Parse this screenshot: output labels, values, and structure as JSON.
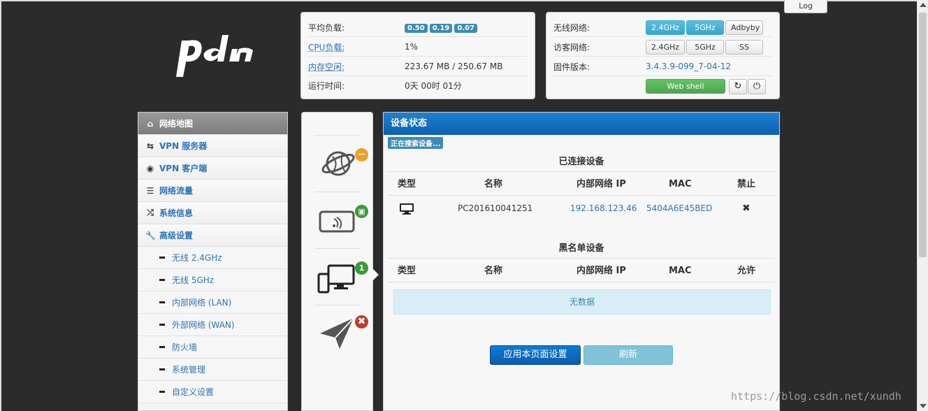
{
  "topbar": {
    "log_label": "Log"
  },
  "logo": {
    "text": "pdcn"
  },
  "system_stats": {
    "load_label": "平均负载:",
    "load_values": [
      "0.50",
      "0.19",
      "0.07"
    ],
    "cpu_label": "CPU负载:",
    "cpu_value": "1%",
    "mem_label": "内存空闲:",
    "mem_value": "223.67 MB / 250.67 MB",
    "uptime_label": "运行时间:",
    "uptime_value": "0天 00时 01分"
  },
  "network_info": {
    "wireless_label": "无线网络:",
    "wireless_buttons": [
      "2.4GHz",
      "5GHz",
      "Adbyby"
    ],
    "guest_label": "访客网络:",
    "guest_buttons": [
      "2.4GHz",
      "5GHz",
      "SS"
    ],
    "firmware_label": "固件版本:",
    "firmware_value": "3.4.3.9-099_7-04-12",
    "webshell_label": "Web shell"
  },
  "sidebar": {
    "items": [
      {
        "label": "网络地图",
        "icon": "home-icon",
        "active": true
      },
      {
        "label": "VPN 服务器",
        "icon": "retweet-icon"
      },
      {
        "label": "VPN 客户端",
        "icon": "globe-icon"
      },
      {
        "label": "网络流量",
        "icon": "list-icon"
      },
      {
        "label": "系统信息",
        "icon": "random-icon"
      },
      {
        "label": "高级设置",
        "icon": "wrench-icon"
      }
    ],
    "subitems": [
      "无线 2.4GHz",
      "无线 5GHz",
      "内部网络 (LAN)",
      "外部网络 (WAN)",
      "防火墙",
      "系统管理",
      "自定义设置"
    ]
  },
  "device_icons": {
    "badges": [
      "1"
    ]
  },
  "main": {
    "title": "设备状态",
    "searching_label": "正在搜索设备...",
    "connected_title": "已连接设备",
    "connected_headers": [
      "类型",
      "名称",
      "内部网络 IP",
      "MAC",
      "禁止"
    ],
    "connected_rows": [
      {
        "name": "PC201610041251",
        "ip": "192.168.123.46",
        "mac": "5404A6E45BED"
      }
    ],
    "blacklist_title": "黑名单设备",
    "blacklist_headers": [
      "类型",
      "名称",
      "内部网络 IP",
      "MAC",
      "允许"
    ],
    "no_data": "无数据",
    "apply_label": "应用本页面设置",
    "refresh_label": "刷新"
  },
  "watermark": "https://blog.csdn.net/xundh",
  "colors": {
    "background": "#2b2b2b",
    "header_blue": "#0b5fb0",
    "link_blue": "#2a73b8",
    "badge_blue": "#3d8bb5",
    "green": "#51a351"
  }
}
